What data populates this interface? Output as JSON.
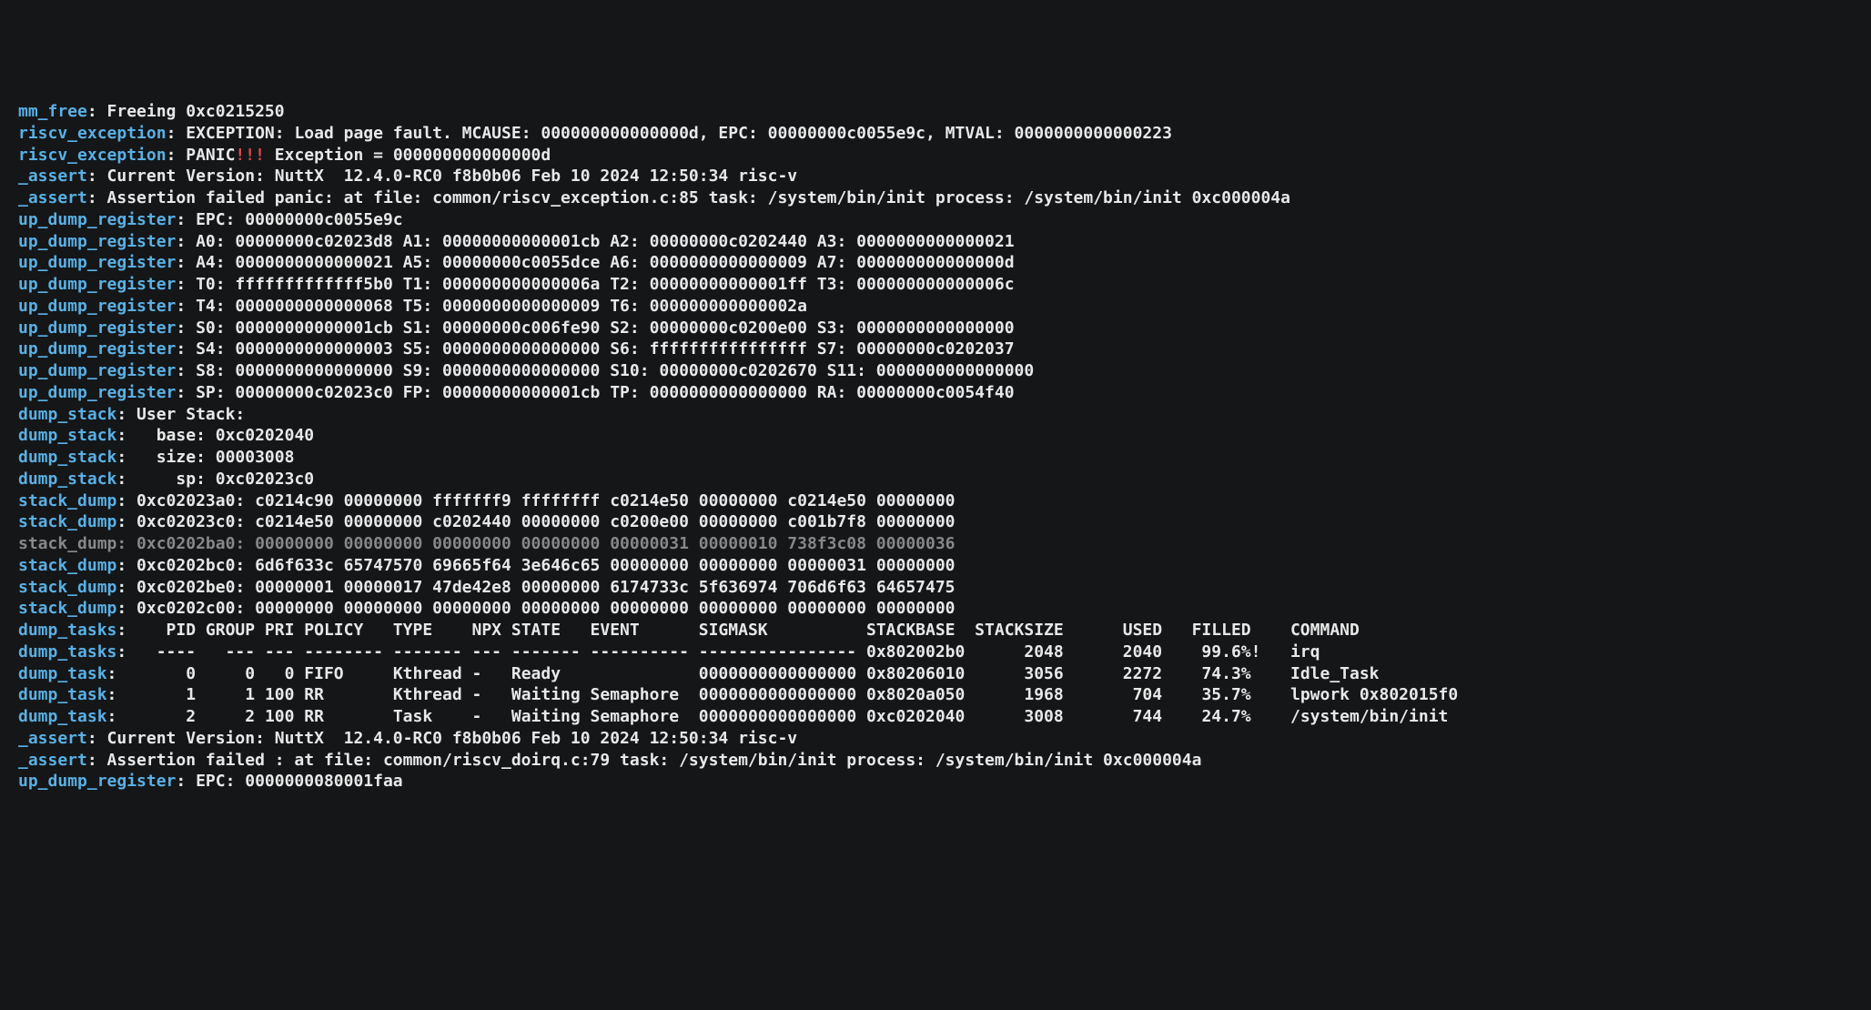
{
  "lines": [
    {
      "parts": [
        {
          "cls": "tag",
          "text": "mm_free"
        },
        {
          "cls": "",
          "text": ": Freeing 0xc0215250"
        }
      ]
    },
    {
      "parts": [
        {
          "cls": "tag",
          "text": "riscv_exception"
        },
        {
          "cls": "",
          "text": ": EXCEPTION: Load page fault. MCAUSE: 000000000000000d, EPC: 00000000c0055e9c, MTVAL: 0000000000000223"
        }
      ]
    },
    {
      "parts": [
        {
          "cls": "tag",
          "text": "riscv_exception"
        },
        {
          "cls": "",
          "text": ": PANIC"
        },
        {
          "cls": "red",
          "text": "!!!"
        },
        {
          "cls": "",
          "text": " Exception = 000000000000000d"
        }
      ]
    },
    {
      "parts": [
        {
          "cls": "tag",
          "text": "_assert"
        },
        {
          "cls": "",
          "text": ": Current Version: NuttX  12.4.0-RC0 f8b0b06 Feb 10 2024 12:50:34 risc-v"
        }
      ]
    },
    {
      "parts": [
        {
          "cls": "tag",
          "text": "_assert"
        },
        {
          "cls": "",
          "text": ": Assertion failed panic: at file: common/riscv_exception.c:85 task: /system/bin/init process: /system/bin/init 0xc000004a"
        }
      ]
    },
    {
      "parts": [
        {
          "cls": "tag",
          "text": "up_dump_register"
        },
        {
          "cls": "",
          "text": ": EPC: 00000000c0055e9c"
        }
      ]
    },
    {
      "parts": [
        {
          "cls": "tag",
          "text": "up_dump_register"
        },
        {
          "cls": "",
          "text": ": A0: 00000000c02023d8 A1: 00000000000001cb A2: 00000000c0202440 A3: 0000000000000021"
        }
      ]
    },
    {
      "parts": [
        {
          "cls": "tag",
          "text": "up_dump_register"
        },
        {
          "cls": "",
          "text": ": A4: 0000000000000021 A5: 00000000c0055dce A6: 0000000000000009 A7: 000000000000000d"
        }
      ]
    },
    {
      "parts": [
        {
          "cls": "tag",
          "text": "up_dump_register"
        },
        {
          "cls": "",
          "text": ": T0: fffffffffffff5b0 T1: 000000000000006a T2: 00000000000001ff T3: 000000000000006c"
        }
      ]
    },
    {
      "parts": [
        {
          "cls": "tag",
          "text": "up_dump_register"
        },
        {
          "cls": "",
          "text": ": T4: 0000000000000068 T5: 0000000000000009 T6: 000000000000002a"
        }
      ]
    },
    {
      "parts": [
        {
          "cls": "tag",
          "text": "up_dump_register"
        },
        {
          "cls": "",
          "text": ": S0: 00000000000001cb S1: 00000000c006fe90 S2: 00000000c0200e00 S3: 0000000000000000"
        }
      ]
    },
    {
      "parts": [
        {
          "cls": "tag",
          "text": "up_dump_register"
        },
        {
          "cls": "",
          "text": ": S4: 0000000000000003 S5: 0000000000000000 S6: ffffffffffffffff S7: 00000000c0202037"
        }
      ]
    },
    {
      "parts": [
        {
          "cls": "tag",
          "text": "up_dump_register"
        },
        {
          "cls": "",
          "text": ": S8: 0000000000000000 S9: 0000000000000000 S10: 00000000c0202670 S11: 0000000000000000"
        }
      ]
    },
    {
      "parts": [
        {
          "cls": "tag",
          "text": "up_dump_register"
        },
        {
          "cls": "",
          "text": ": SP: 00000000c02023c0 FP: 00000000000001cb TP: 0000000000000000 RA: 00000000c0054f40"
        }
      ]
    },
    {
      "parts": [
        {
          "cls": "tag",
          "text": "dump_stack"
        },
        {
          "cls": "",
          "text": ": User Stack:"
        }
      ]
    },
    {
      "parts": [
        {
          "cls": "tag",
          "text": "dump_stack"
        },
        {
          "cls": "",
          "text": ":   base: 0xc0202040"
        }
      ]
    },
    {
      "parts": [
        {
          "cls": "tag",
          "text": "dump_stack"
        },
        {
          "cls": "",
          "text": ":   size: 00003008"
        }
      ]
    },
    {
      "parts": [
        {
          "cls": "tag",
          "text": "dump_stack"
        },
        {
          "cls": "",
          "text": ":     sp: 0xc02023c0"
        }
      ]
    },
    {
      "parts": [
        {
          "cls": "tag",
          "text": "stack_dump"
        },
        {
          "cls": "",
          "text": ": 0xc02023a0: c0214c90 00000000 fffffff9 ffffffff c0214e50 00000000 c0214e50 00000000"
        }
      ]
    },
    {
      "parts": [
        {
          "cls": "tag",
          "text": "stack_dump"
        },
        {
          "cls": "",
          "text": ": 0xc02023c0: c0214e50 00000000 c0202440 00000000 c0200e00 00000000 c001b7f8 00000000"
        }
      ]
    },
    {
      "parts": [
        {
          "cls": "faded",
          "text": "stack_dump: 0xc0202ba0: 00000000 00000000 00000000 00000000 00000031 00000010 738f3c08 00000036"
        }
      ]
    },
    {
      "parts": [
        {
          "cls": "tag",
          "text": "stack_dump"
        },
        {
          "cls": "",
          "text": ": 0xc0202bc0: 6d6f633c 65747570 69665f64 3e646c65 00000000 00000000 00000031 00000000"
        }
      ]
    },
    {
      "parts": [
        {
          "cls": "tag",
          "text": "stack_dump"
        },
        {
          "cls": "",
          "text": ": 0xc0202be0: 00000001 00000017 47de42e8 00000000 6174733c 5f636974 706d6f63 64657475"
        }
      ]
    },
    {
      "parts": [
        {
          "cls": "tag",
          "text": "stack_dump"
        },
        {
          "cls": "",
          "text": ": 0xc0202c00: 00000000 00000000 00000000 00000000 00000000 00000000 00000000 00000000"
        }
      ]
    },
    {
      "parts": [
        {
          "cls": "tag",
          "text": "dump_tasks"
        },
        {
          "cls": "",
          "text": ":    PID GROUP PRI POLICY   TYPE    NPX STATE   EVENT      SIGMASK          STACKBASE  STACKSIZE      USED   FILLED    COMMAND"
        }
      ]
    },
    {
      "parts": [
        {
          "cls": "tag",
          "text": "dump_tasks"
        },
        {
          "cls": "",
          "text": ":   ----   --- --- -------- ------- --- ------- ---------- ---------------- 0x802002b0      2048      2040    99.6%!   irq"
        }
      ]
    },
    {
      "parts": [
        {
          "cls": "tag",
          "text": "dump_task"
        },
        {
          "cls": "",
          "text": ":       0     0   0 FIFO     Kthread -   Ready              0000000000000000 0x80206010      3056      2272    74.3%    Idle_Task"
        }
      ]
    },
    {
      "parts": [
        {
          "cls": "tag",
          "text": "dump_task"
        },
        {
          "cls": "",
          "text": ":       1     1 100 RR       Kthread -   Waiting Semaphore  0000000000000000 0x8020a050      1968       704    35.7%    lpwork 0x802015f0"
        }
      ]
    },
    {
      "parts": [
        {
          "cls": "tag",
          "text": "dump_task"
        },
        {
          "cls": "",
          "text": ":       2     2 100 RR       Task    -   Waiting Semaphore  0000000000000000 0xc0202040      3008       744    24.7%    /system/bin/init"
        }
      ]
    },
    {
      "parts": [
        {
          "cls": "tag",
          "text": "_assert"
        },
        {
          "cls": "",
          "text": ": Current Version: NuttX  12.4.0-RC0 f8b0b06 Feb 10 2024 12:50:34 risc-v"
        }
      ]
    },
    {
      "parts": [
        {
          "cls": "tag",
          "text": "_assert"
        },
        {
          "cls": "",
          "text": ": Assertion failed : at file: common/riscv_doirq.c:79 task: /system/bin/init process: /system/bin/init 0xc000004a"
        }
      ]
    },
    {
      "parts": [
        {
          "cls": "tag",
          "text": "up_dump_register"
        },
        {
          "cls": "",
          "text": ": EPC: 0000000080001faa"
        }
      ]
    }
  ]
}
